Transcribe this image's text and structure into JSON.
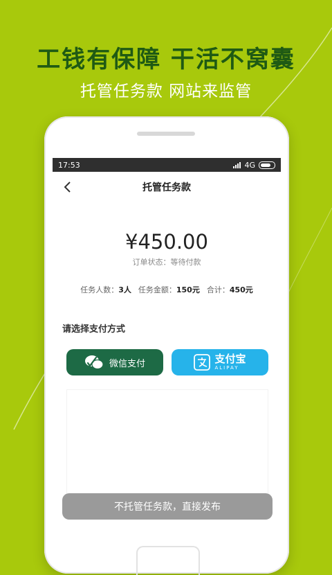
{
  "promo": {
    "headline": "工钱有保障  干活不窝囊",
    "subline": "托管任务款 网站来监管"
  },
  "statusbar": {
    "time": "17:53",
    "network": "4G"
  },
  "navbar": {
    "title": "托管任务款"
  },
  "order": {
    "amount": "¥450.00",
    "status": "订单状态：等待付款",
    "people_label": "任务人数：",
    "people_value": "3人",
    "price_label": "任务金额：",
    "price_value": "150元",
    "total_label": "合计：",
    "total_value": "450元"
  },
  "payment": {
    "section_title": "请选择支付方式",
    "wechat_label": "微信支付",
    "alipay_label_cn": "支付宝",
    "alipay_label_en": "ALIPAY"
  },
  "actions": {
    "direct_publish": "不托管任务款，直接发布"
  },
  "colors": {
    "background": "#a8c90c",
    "headline": "#1f5a14",
    "wechat": "#1d6a45",
    "alipay": "#26b3ea",
    "disabled_button": "#9a9a9a"
  }
}
